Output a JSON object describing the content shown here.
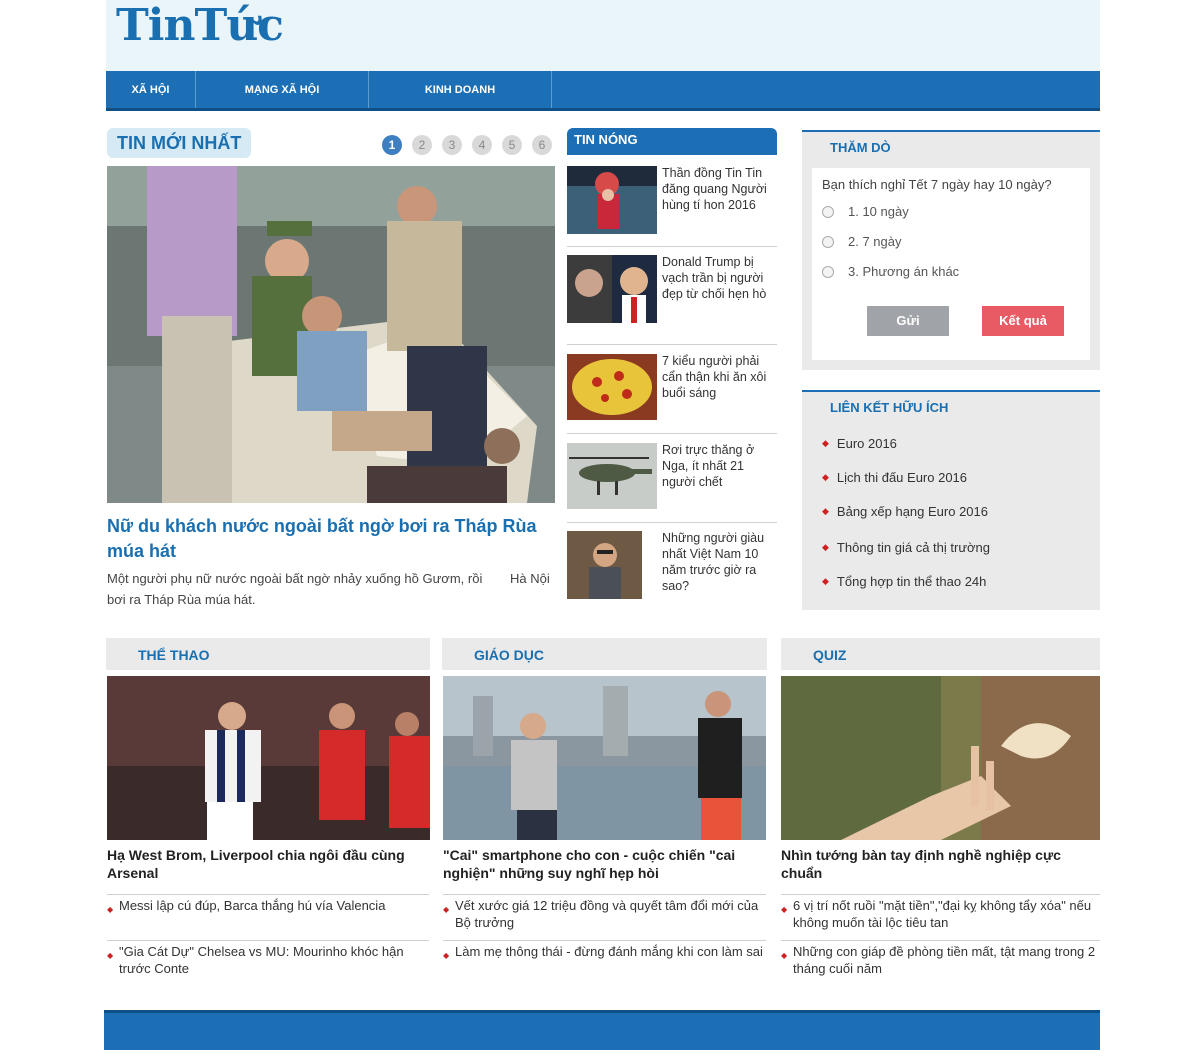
{
  "site": {
    "logo": "TinTức"
  },
  "nav": [
    {
      "label": "XÃ HỘI"
    },
    {
      "label": "MẠNG XÃ HỘI"
    },
    {
      "label": "KINH DOANH"
    }
  ],
  "latest": {
    "title": "TIN MỚI NHẤT",
    "pages": [
      "1",
      "2",
      "3",
      "4",
      "5",
      "6"
    ],
    "headline": "Nữ du khách nước ngoài bất ngờ bơi ra Tháp Rùa múa hát",
    "summary": "Một người phụ nữ nước ngoài bất ngờ nhảy xuống hồ Gươm, rồi bơi ra Tháp Rùa múa hát.",
    "location": "Hà Nội"
  },
  "hot": {
    "title": "TIN NÓNG",
    "items": [
      {
        "text": "Thần đồng Tin Tin đăng quang Người hùng tí hon 2016"
      },
      {
        "text": "Donald Trump bị vạch trần bị người đẹp từ chối hẹn hò"
      },
      {
        "text": "7 kiểu người phải cẩn thận khi ăn xôi buổi sáng"
      },
      {
        "text": "Rơi trực thăng ở Nga, ít nhất 21 người chết"
      },
      {
        "text": "Những người giàu nhất Việt Nam 10 năm trước giờ ra sao?"
      }
    ]
  },
  "poll": {
    "title": "THĂM DÒ",
    "question": "Bạn thích nghỉ Tết 7 ngày hay 10 ngày?",
    "options": [
      "1. 10 ngày",
      "2. 7 ngày",
      "3. Phương án khác"
    ],
    "submit": "Gửi",
    "results": "Kết quả"
  },
  "links": {
    "title": "LIÊN KẾT HỮU ÍCH",
    "items": [
      "Euro 2016",
      "Lịch thi đấu Euro 2016",
      "Bảng xếp hạng Euro 2016",
      "Thông tin giá cả thị trường",
      "Tổng hợp tin thể thao 24h"
    ]
  },
  "categories": [
    {
      "title": "THỂ THAO",
      "headline": "Hạ West Brom, Liverpool chia ngôi đầu cùng Arsenal",
      "links": [
        "Messi lập cú đúp, Barca thắng hú vía Valencia",
        "\"Gia Cát Dự\" Chelsea vs MU: Mourinho khóc hận trước Conte"
      ]
    },
    {
      "title": "GIÁO DỤC",
      "headline": "\"Cai\" smartphone cho con - cuộc chiến \"cai nghiện\" những suy nghĩ hẹp hòi",
      "links": [
        "Vết xước giá 12 triệu đồng và quyết tâm đổi mới của Bộ trưởng",
        "Làm mẹ thông thái - đừng đánh mắng khi con làm sai"
      ]
    },
    {
      "title": "QUIZ",
      "headline": "Nhìn tướng bàn tay định nghề nghiệp cực chuẩn",
      "links": [
        "6 vị trí nốt ruồi \"mặt tiền\",\"đại kỵ không tẩy xóa\" nếu không muốn tài lộc tiêu tan",
        "Những con giáp đề phòng tiền mất, tật mang trong 2 tháng cuối năm"
      ]
    }
  ],
  "colors": {
    "brand": "#1c6fb4",
    "accent_red": "#e85a64",
    "gray_button": "#a0a4a8"
  }
}
